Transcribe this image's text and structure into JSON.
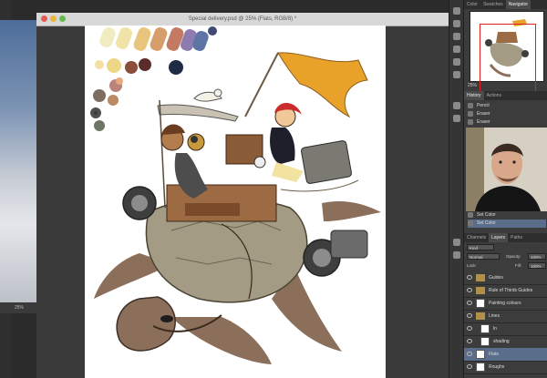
{
  "document": {
    "title": "Special delivery.psd @ 25% (Flats, RGB/8) *",
    "background_zoom": "25%"
  },
  "right_panel": {
    "navigator_tabs": [
      "Color",
      "Swatches",
      "Navigator"
    ],
    "navigator_zoom": "25%",
    "history_tabs": [
      "History",
      "Actions"
    ],
    "history_items": [
      "Pencil",
      "Eraser",
      "Eraser"
    ],
    "history_bottom_items": [
      "Set Color",
      "Set Color"
    ],
    "layers_tabs": [
      "Channels",
      "Layers",
      "Paths"
    ],
    "kind_filter": "Kind",
    "blend_mode": "Normal",
    "opacity_label": "Opacity:",
    "opacity_value": "100%",
    "lock_label": "Lock:",
    "fill_label": "Fill:",
    "fill_value": "100%",
    "layers": [
      "Guides",
      "Rule of Thirds Guides",
      "Painting colours",
      "Lines",
      "ln",
      "shading",
      "Flats",
      "Roughs"
    ]
  },
  "colors": {
    "panel_bg": "#3c3c3c",
    "selection": "#5a6e8c",
    "turtle_shell": "#a39b84",
    "flipper": "#8b6f5b",
    "banner": "#e8a22a"
  },
  "palette_swatches": [
    "#f1ecc0",
    "#efe3a7",
    "#e9c47c",
    "#d79d6a",
    "#c27a62",
    "#8e7cb0",
    "#5e74a4",
    "#3e4a73",
    "#f6dfa4",
    "#edd685",
    "#8a4e3b",
    "#5b2d2a",
    "#1f2a44",
    "#b8847a",
    "#7e6e62",
    "#e6a97f",
    "#ba8a65",
    "#4f4f4f",
    "#6e7564",
    "#3b3d30"
  ]
}
